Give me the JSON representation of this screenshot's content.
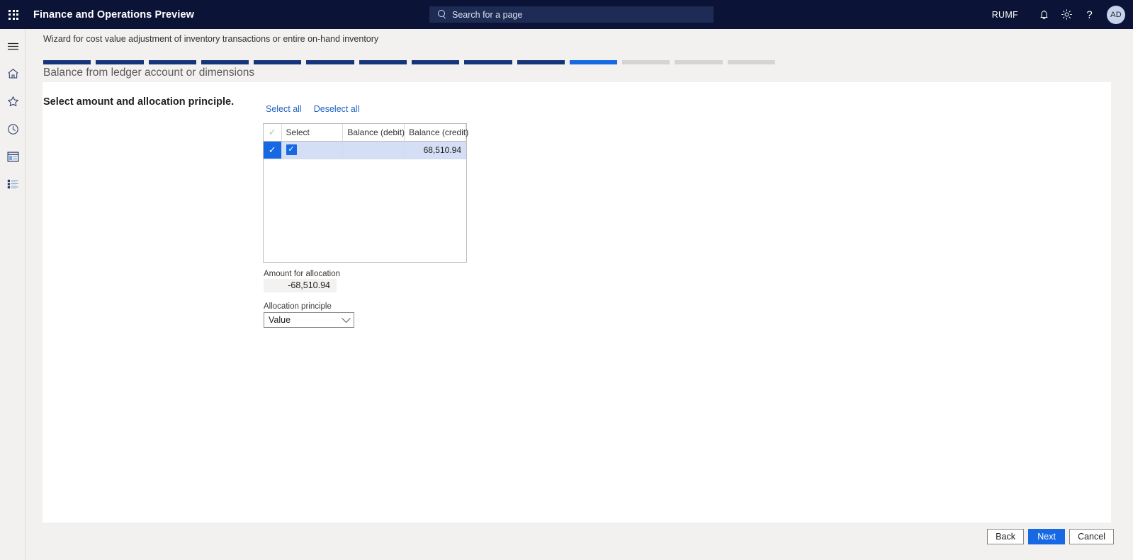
{
  "topbar": {
    "waffle_icon": "app-launcher-icon",
    "app_title": "Finance and Operations Preview",
    "search": {
      "icon": "search-icon",
      "placeholder": "Search for a page",
      "value": ""
    },
    "company_code": "RUMF",
    "notifications_icon": "bell-icon",
    "settings_icon": "gear-icon",
    "help_icon": "question-mark-icon",
    "avatar_initials": "AD"
  },
  "rail": {
    "items": [
      {
        "name": "hamburger-menu",
        "icon": "hamburger-icon"
      },
      {
        "name": "home",
        "icon": "home-icon"
      },
      {
        "name": "favorites",
        "icon": "star-icon"
      },
      {
        "name": "recent",
        "icon": "clock-icon"
      },
      {
        "name": "workspaces",
        "icon": "workspace-window-icon"
      },
      {
        "name": "modules",
        "icon": "list-modules-icon"
      }
    ]
  },
  "wizard": {
    "caption": "Wizard for cost value adjustment of inventory transactions or entire on-hand inventory",
    "step_title": "Balance from ledger account or dimensions",
    "progress": {
      "total_steps": 14,
      "completed": 10,
      "active_index": 10,
      "states": [
        "done",
        "done",
        "done",
        "done",
        "done",
        "done",
        "done",
        "done",
        "done",
        "done",
        "active",
        "todo",
        "todo",
        "todo"
      ],
      "colors": {
        "done": "#15357a",
        "active": "#1668e3",
        "todo": "#d5d4d2"
      }
    }
  },
  "content": {
    "section_heading": "Select amount and allocation principle.",
    "links": {
      "select_all": "Select all",
      "deselect_all": "Deselect all"
    },
    "grid": {
      "headers": [
        "",
        "Select",
        "Balance (debit)",
        "Balance (credit)"
      ],
      "rows": [
        {
          "selected": true,
          "select_checkbox": true,
          "balance_debit": "",
          "balance_credit": "68,510.94"
        }
      ]
    },
    "fields": {
      "amount_label": "Amount for allocation",
      "amount_value": "-68,510.94",
      "principle_label": "Allocation principle",
      "principle_value": "Value",
      "principle_options": [
        "Value"
      ]
    }
  },
  "footer": {
    "back_label": "Back",
    "next_label": "Next",
    "cancel_label": "Cancel"
  }
}
